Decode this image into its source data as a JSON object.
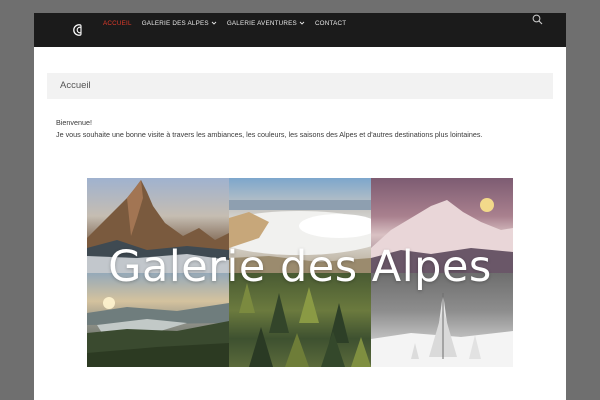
{
  "nav": {
    "items": [
      {
        "label": "ACCUEIL",
        "active": true,
        "dropdown": false
      },
      {
        "label": "GALERIE DES ALPES",
        "active": false,
        "dropdown": true
      },
      {
        "label": "GALERIE AVENTURES",
        "active": false,
        "dropdown": true
      },
      {
        "label": "CONTACT",
        "active": false,
        "dropdown": false
      }
    ],
    "active_color": "#e03a2a",
    "bar_color": "#1b1b1b"
  },
  "header": {
    "logo_icon": "logo-icon",
    "search_icon": "search-icon"
  },
  "main": {
    "title": "Accueil",
    "greeting": "Bienvenue!",
    "intro": "Je vous souhaite une bonne visite à travers les ambiances, les couleurs, les saisons des Alpes et d'autres destinations plus lointaines."
  },
  "banner": {
    "title": "Galerie des Alpes"
  }
}
